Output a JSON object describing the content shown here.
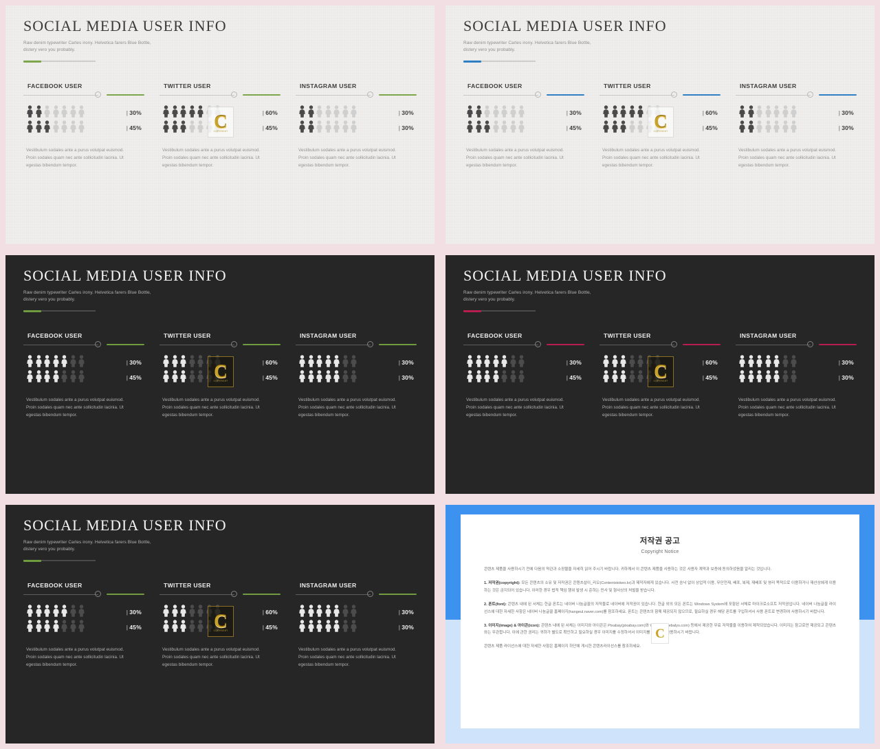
{
  "theme": {
    "gap_color": "#f2dfe4",
    "light_bg": "#efeeec",
    "dark_bg": "#262626",
    "accent_green": "#7da64a",
    "accent_blue": "#2f7fc4",
    "accent_crimson": "#b81d4f",
    "gold": "#c9a227"
  },
  "common": {
    "title": "SOCIAL MEDIA USER INFO",
    "subtitle_line1": "Raw denim typewriter Carles irony. Helvetica farers Blue Bottle,",
    "subtitle_line2": "distery vero you probably.",
    "body_text": "Vestibulum sodales ante a purus volutpat euismod. Proin sodales quam nec ante sollicitudin lacinia. Ut egestas bibendum tempor.",
    "watermark_letter": "C",
    "watermark_caption": "COPYRIGHT",
    "bar_glyph": "|"
  },
  "slides": [
    {
      "id": "slide-1-light-green",
      "variant": "light",
      "accent": "#7da64a",
      "columns": [
        {
          "label": "FACEBOOK USER",
          "rows": [
            {
              "pct": "30%",
              "filled": 2,
              "total": 7
            },
            {
              "pct": "45%",
              "filled": 3,
              "total": 7
            }
          ]
        },
        {
          "label": "TWITTER USER",
          "watermark": true,
          "rows": [
            {
              "pct": "60%",
              "filled": 5,
              "total": 7
            },
            {
              "pct": "45%",
              "filled": 3,
              "total": 7
            }
          ]
        },
        {
          "label": "INSTAGRAM USER",
          "rows": [
            {
              "pct": "30%",
              "filled": 2,
              "total": 7
            },
            {
              "pct": "30%",
              "filled": 2,
              "total": 7
            }
          ]
        }
      ]
    },
    {
      "id": "slide-2-light-blue",
      "variant": "light",
      "accent": "#2f7fc4",
      "columns": [
        {
          "label": "FACEBOOK USER",
          "rows": [
            {
              "pct": "30%",
              "filled": 2,
              "total": 7
            },
            {
              "pct": "45%",
              "filled": 3,
              "total": 7
            }
          ]
        },
        {
          "label": "TWITTER USER",
          "watermark": true,
          "rows": [
            {
              "pct": "60%",
              "filled": 5,
              "total": 7
            },
            {
              "pct": "45%",
              "filled": 3,
              "total": 7
            }
          ]
        },
        {
          "label": "INSTAGRAM USER",
          "rows": [
            {
              "pct": "30%",
              "filled": 2,
              "total": 7
            },
            {
              "pct": "30%",
              "filled": 2,
              "total": 7
            }
          ]
        }
      ]
    },
    {
      "id": "slide-3-dark-green",
      "variant": "dark",
      "accent": "#6f9c3f",
      "columns": [
        {
          "label": "FACEBOOK USER",
          "rows": [
            {
              "pct": "30%",
              "filled": 5,
              "total": 7
            },
            {
              "pct": "45%",
              "filled": 4,
              "total": 7
            }
          ]
        },
        {
          "label": "TWITTER USER",
          "watermark": true,
          "rows": [
            {
              "pct": "60%",
              "filled": 3,
              "total": 7
            },
            {
              "pct": "45%",
              "filled": 3,
              "total": 7
            }
          ]
        },
        {
          "label": "INSTAGRAM USER",
          "rows": [
            {
              "pct": "30%",
              "filled": 5,
              "total": 7
            },
            {
              "pct": "30%",
              "filled": 5,
              "total": 7
            }
          ]
        }
      ]
    },
    {
      "id": "slide-4-dark-crimson",
      "variant": "dark",
      "accent": "#b81d4f",
      "columns": [
        {
          "label": "FACEBOOK USER",
          "rows": [
            {
              "pct": "30%",
              "filled": 5,
              "total": 7
            },
            {
              "pct": "45%",
              "filled": 4,
              "total": 7
            }
          ]
        },
        {
          "label": "TWITTER USER",
          "watermark": true,
          "rows": [
            {
              "pct": "60%",
              "filled": 3,
              "total": 7
            },
            {
              "pct": "45%",
              "filled": 3,
              "total": 7
            }
          ]
        },
        {
          "label": "INSTAGRAM USER",
          "rows": [
            {
              "pct": "30%",
              "filled": 5,
              "total": 7
            },
            {
              "pct": "30%",
              "filled": 5,
              "total": 7
            }
          ]
        }
      ]
    },
    {
      "id": "slide-5-dark-green-b",
      "variant": "dark",
      "accent": "#6f9c3f",
      "columns": [
        {
          "label": "FACEBOOK USER",
          "rows": [
            {
              "pct": "30%",
              "filled": 5,
              "total": 7
            },
            {
              "pct": "45%",
              "filled": 4,
              "total": 7
            }
          ]
        },
        {
          "label": "TWITTER USER",
          "watermark": true,
          "rows": [
            {
              "pct": "60%",
              "filled": 3,
              "total": 7
            },
            {
              "pct": "45%",
              "filled": 3,
              "total": 7
            }
          ]
        },
        {
          "label": "INSTAGRAM USER",
          "rows": [
            {
              "pct": "30%",
              "filled": 5,
              "total": 7
            },
            {
              "pct": "30%",
              "filled": 5,
              "total": 7
            }
          ]
        }
      ]
    }
  ],
  "copyright_slide": {
    "id": "slide-6-copyright",
    "title_ko": "저작권 공고",
    "title_en": "Copyright Notice",
    "watermark_letter": "C",
    "paragraphs": [
      "콘텐츠 제품을 사용하시기 전에 다음의 약관과 소장물을 자세히 읽어 주시기 바랍니다. 귀하께서 이 콘텐츠 제품을 사용하는 것은 사용자 계약과 보증에 동의하셨음을 알리는 것입니다.",
      "1. 저작권(copyright): 모든 콘텐츠의 소유 및 저작권은 콘텐츠샵이_리오(Contentstokeo.kr)과 제작자에게 있습니다. 사전 승낙 없이 상업적 이용, 무단전재, 배포, 복제, 재배포 및 영리 목적으로 이용하거나 재산상에게 이용하는 것은 금지되어 있습니다. 이러한 경우 법적 책임 행위 발생 시 준하는 민사 및 형사상의 처벌을 받습니다.",
      "2. 폰트(font): 콘텐츠 내에 된 서체는 한글 폰트는 네이버 나눔글꼴의 저작물로 네이버에 저작권이 있습니다. 한글 외의 모든 폰트는 Windows System에 포함된 서체로 마이크로소프트 저작권입니다. 네이버 나눔글꼴 라이선스에 대한 자세한 사항은 네이버 나눔글꼴 홈페이지(hangeul.naver.com)를 참조하세요. 폰트는 콘텐츠의 함께 제공되지 않으므로, 필요하실 경우 해당 폰트를 구입하셔서 사용 폰트로 변경하여 사용하시기 바랍니다.",
      "3. 이미지(image) & 아이콘(icon): 콘텐츠 내에 된 서체는 이미지와 아이콘은 Pixabay(pixabay.com)와 Webalys(webalys.com) 등에서 제공한 무료 저작물을 이용하여 제작되었습니다. 이미지는 참고로만 제공되고 콘텐츠와는 무관합니다. 이에 관한 권리는 귀하가 별도로 확인하고 필요하실 경우 이미지를 수정하셔서 이미지를 변경하여 사용하시기 바랍니다.",
      "콘텐츠 제품 라이선스에 대한 자세한 사항은 홈페이지 하단에 게시한 콘텐츠라이선스를 참조하세요."
    ]
  }
}
